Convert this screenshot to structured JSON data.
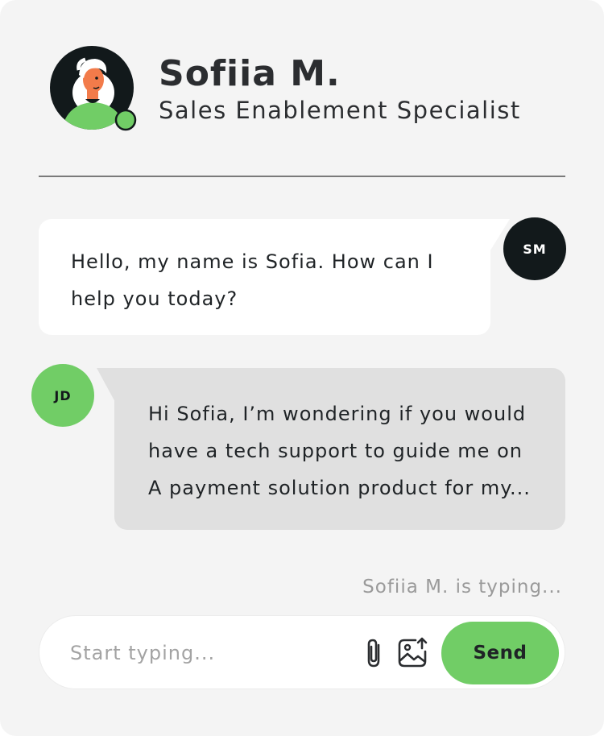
{
  "header": {
    "name": "Sofiia M.",
    "role": "Sales Enablement Specialist",
    "avatar_icon": "person-avatar-icon",
    "online_indicator_color": "#71cd66"
  },
  "messages": [
    {
      "sender_initials": "SM",
      "text": "Hello, my name is Sofia. How can I help you today?"
    },
    {
      "sender_initials": "JD",
      "text_lines": [
        "Hi Sofia, I’m wondering if you would",
        "have a tech support to guide me on",
        "A payment solution product for my..."
      ]
    }
  ],
  "typing_indicator": "Sofiia M. is typing...",
  "composer": {
    "placeholder": "Start typing...",
    "attach_icon": "paperclip-icon",
    "image_icon": "image-upload-icon",
    "send_label": "Send"
  },
  "colors": {
    "accent": "#71cd66",
    "dark": "#12191b",
    "background": "#f4f4f4",
    "user_bubble": "#e0e0e0"
  }
}
